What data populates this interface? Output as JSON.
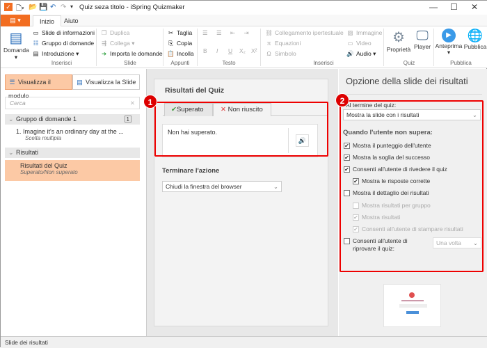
{
  "window": {
    "title": "Quiz seza titolo - iSpring Quizmaker",
    "minimize": "—",
    "maximize": "☐",
    "close": "✕"
  },
  "ribbon_tabs": [
    {
      "label": "Inizio",
      "active": true
    },
    {
      "label": "Aiuto",
      "active": false
    }
  ],
  "ribbon": {
    "inserisci": {
      "domanda": "Domanda",
      "slide_info": "Slide di informazioni",
      "gruppo": "Gruppo di domande",
      "intro": "Introduzione",
      "group": "Inserisci"
    },
    "slide": {
      "duplica": "Duplica",
      "collega": "Collega",
      "importa": "Importa le domande",
      "group": "Slide"
    },
    "appunti": {
      "taglia": "Taglia",
      "copia": "Copia",
      "incolla": "Incolla",
      "group": "Appunti"
    },
    "testo": {
      "group": "Testo",
      "bold": "B",
      "italic": "I",
      "underline": "U",
      "sub": "X₂",
      "sup": "X²"
    },
    "inserisci2": {
      "link": "Collegamento ipertestuale",
      "eq": "Equazioni",
      "sym": "Simbolo",
      "img": "Immagine",
      "video": "Video",
      "audio": "Audio",
      "group": "Inserisci"
    },
    "quiz": {
      "prop": "Proprietà",
      "player": "Player",
      "group": "Quiz"
    },
    "pubblica": {
      "preview": "Anteprima",
      "publish": "Pubblica",
      "group": "Pubblica"
    }
  },
  "left": {
    "view_form": "Visualizza il modulo",
    "view_slide": "Visualizza la Slide",
    "search_placeholder": "Cerca",
    "group1": {
      "label": "Gruppo di domande 1",
      "count": "1"
    },
    "q1": {
      "label": "1.  Imagine it's an ordinary day at the ...",
      "type": "Scelta multipla"
    },
    "group2": {
      "label": "Risultati"
    },
    "result": {
      "label": "Risultati del Quiz",
      "sub": "Superato/Non superato"
    }
  },
  "center": {
    "title": "Risultati del Quiz",
    "badge": "1",
    "tab_pass": "Superato",
    "tab_fail": "Non riuscito",
    "message": "Non hai superato.",
    "end_label": "Terminare l'azione",
    "end_value": "Chiudi la finestra del browser"
  },
  "right": {
    "title": "Opzione della slide dei risultati",
    "badge": "2",
    "end_quiz_label": "Al termine del quiz:",
    "end_quiz_value": "Mostra la slide con i risultati",
    "fail_heading": "Quando l'utente non supera:",
    "options": [
      {
        "label": "Mostra il punteggio dell'utente",
        "checked": true,
        "enabled": true
      },
      {
        "label": "Mostra la soglia del successo",
        "checked": true,
        "enabled": true
      },
      {
        "label": "Consenti all'utente di rivedere il quiz",
        "checked": true,
        "enabled": true
      },
      {
        "label": "Mostra le risposte corrette",
        "checked": true,
        "enabled": true
      },
      {
        "label": "Mostra il dettaglio dei risultati",
        "checked": false,
        "enabled": true
      },
      {
        "label": "Mostra risultati per gruppo",
        "checked": false,
        "enabled": false
      },
      {
        "label": "Mostra risultati",
        "checked": true,
        "enabled": false
      },
      {
        "label": "Consenti all'utente di stampare risultati",
        "checked": true,
        "enabled": false
      }
    ],
    "retry_label1": "Consenti all'utente di",
    "retry_label2": "riprovare il quiz:",
    "retry_value": "Una volta"
  },
  "status": "Slide dei risultati",
  "colors": {
    "accent": "#f26d21",
    "highlight": "#fcc9a5",
    "annotation": "#e00000"
  }
}
